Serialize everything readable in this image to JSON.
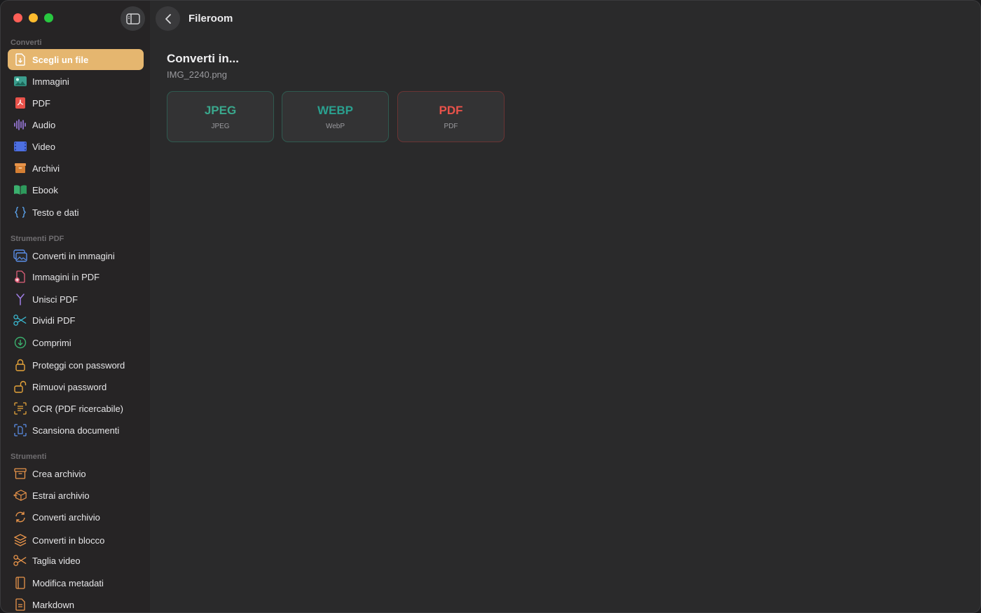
{
  "window": {
    "title": "Fileroom"
  },
  "colors": {
    "accent": "#e5b66f",
    "jpeg": "#3aa88d",
    "webp": "#2aa08f",
    "pdf": "#e8524a"
  },
  "sidebar": {
    "sections": [
      {
        "label": "Converti",
        "items": [
          {
            "label": "Scegli un file",
            "icon": "file-download-icon",
            "active": true
          },
          {
            "label": "Immagini",
            "icon": "image-icon"
          },
          {
            "label": "PDF",
            "icon": "pdf-icon"
          },
          {
            "label": "Audio",
            "icon": "waveform-icon"
          },
          {
            "label": "Video",
            "icon": "film-icon"
          },
          {
            "label": "Archivi",
            "icon": "archive-box-icon"
          },
          {
            "label": "Ebook",
            "icon": "book-icon"
          },
          {
            "label": "Testo e dati",
            "icon": "curly-braces-icon"
          }
        ]
      },
      {
        "label": "Strumenti PDF",
        "items": [
          {
            "label": "Converti in immagini",
            "icon": "photo-stack-icon"
          },
          {
            "label": "Immagini in PDF",
            "icon": "doc-plus-icon"
          },
          {
            "label": "Unisci PDF",
            "icon": "merge-icon"
          },
          {
            "label": "Dividi PDF",
            "icon": "scissors-icon"
          },
          {
            "label": "Comprimi",
            "icon": "compress-icon"
          },
          {
            "label": "Proteggi con password",
            "icon": "lock-icon"
          },
          {
            "label": "Rimuovi password",
            "icon": "unlock-icon"
          },
          {
            "label": "OCR (PDF ricercabile)",
            "icon": "text-scan-icon"
          },
          {
            "label": "Scansiona documenti",
            "icon": "doc-scan-icon"
          }
        ]
      },
      {
        "label": "Strumenti",
        "items": [
          {
            "label": "Crea archivio",
            "icon": "archive-create-icon"
          },
          {
            "label": "Estrai archivio",
            "icon": "package-extract-icon"
          },
          {
            "label": "Converti archivio",
            "icon": "refresh-icon"
          },
          {
            "label": "Converti in blocco",
            "icon": "layers-icon"
          },
          {
            "label": "Taglia video",
            "icon": "scissors-video-icon"
          },
          {
            "label": "Modifica metadati",
            "icon": "book-edit-icon"
          },
          {
            "label": "Markdown",
            "icon": "markdown-doc-icon"
          }
        ]
      }
    ]
  },
  "main": {
    "title": "Converti in...",
    "file_name": "IMG_2240.png",
    "formats": [
      {
        "label": "JPEG",
        "sub": "JPEG"
      },
      {
        "label": "WEBP",
        "sub": "WebP"
      },
      {
        "label": "PDF",
        "sub": "PDF"
      }
    ]
  }
}
